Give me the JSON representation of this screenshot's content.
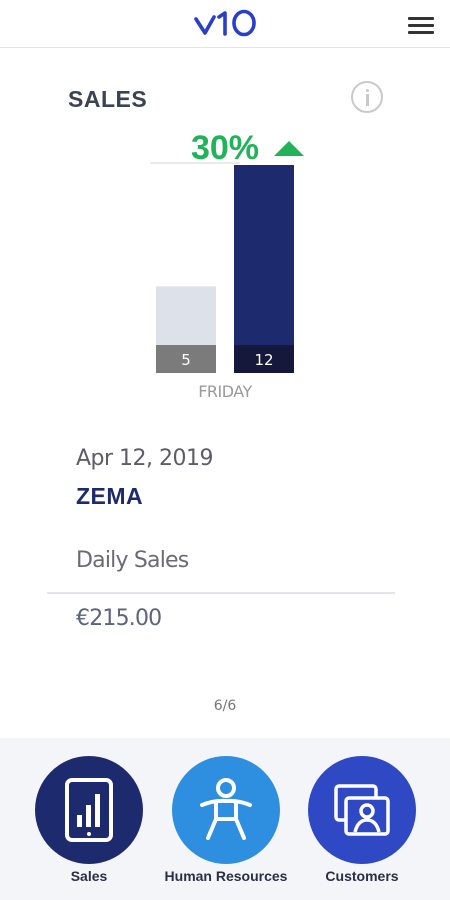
{
  "header": {
    "logo_text": "v10",
    "menu_icon": "hamburger-menu-icon"
  },
  "section": {
    "title": "SALES",
    "info_icon": "info-icon"
  },
  "chart_data": {
    "type": "bar",
    "categories": [
      "FRIDAY"
    ],
    "series": [
      {
        "values": [
          5
        ],
        "color": "#dde1ea",
        "label_bg": "#7b7b7b"
      },
      {
        "values": [
          12
        ],
        "color": "#1e2a6e",
        "label_bg": "#15183a"
      }
    ],
    "change_label": "30%",
    "change_direction": "up",
    "change_color": "#22b35a",
    "ylim": [
      0,
      12
    ]
  },
  "details": {
    "date": "Apr 12, 2019",
    "company": "ZEMA",
    "metric_label": "Daily Sales",
    "metric_value": "€215.00"
  },
  "pager": "6/6",
  "bottom_nav": {
    "items": [
      {
        "label": "Sales",
        "icon": "tablet-chart-icon",
        "color": "#1e2a6e"
      },
      {
        "label": "Human Resources",
        "icon": "person-icon",
        "color": "#2e8fe0"
      },
      {
        "label": "Customers",
        "icon": "customer-cards-icon",
        "color": "#2f48c4"
      }
    ]
  }
}
